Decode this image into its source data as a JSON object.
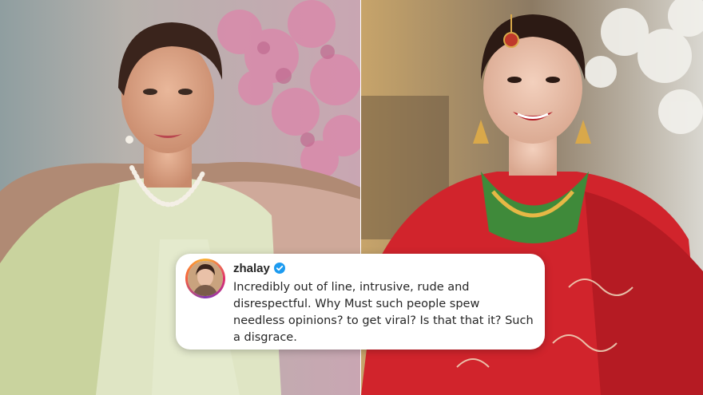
{
  "comment": {
    "username": "zhalay",
    "verified": true,
    "text": "Incredibly out of line, intrusive, rude and disrespectful. Why Must such people spew needless opinions? to get viral? Is that that it? Such a disgrace."
  },
  "icons": {
    "avatar": "profile-photo",
    "verified": "verified-badge-icon"
  },
  "colors": {
    "verified_badge": "#1d9bf0",
    "avatar_ring": "#e1306c",
    "left_dress": "#dfe5c4",
    "right_dress": "#d1242c"
  }
}
